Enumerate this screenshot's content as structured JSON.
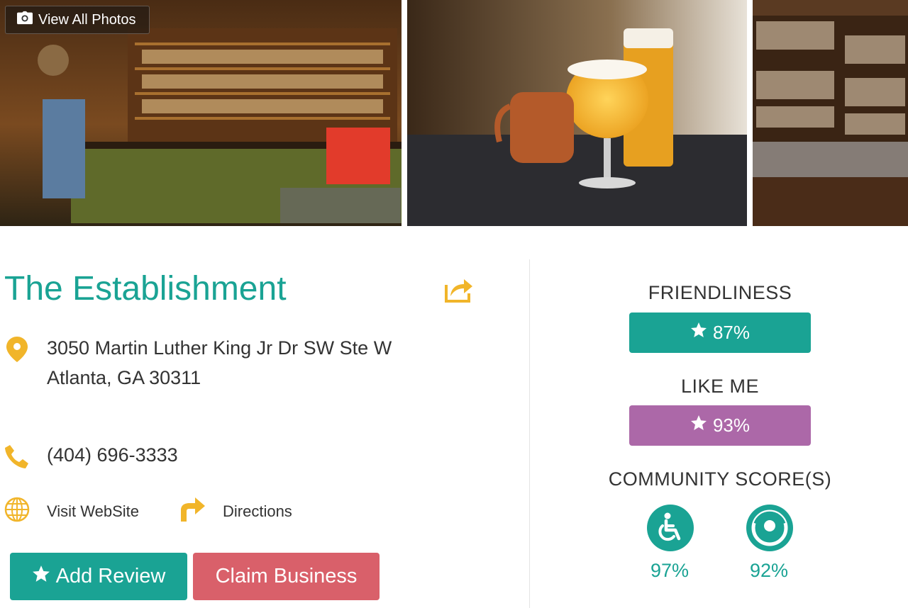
{
  "gallery": {
    "view_all_label": "View All Photos"
  },
  "business": {
    "name": "The Establishment",
    "address_line1": "3050 Martin Luther King Jr Dr SW Ste W",
    "address_line2": "Atlanta, GA 30311",
    "phone": "(404) 696-3333",
    "website_label": "Visit WebSite",
    "directions_label": "Directions"
  },
  "actions": {
    "add_review_label": "Add Review",
    "claim_business_label": "Claim Business"
  },
  "scores": {
    "friendliness_label": "FRIENDLINESS",
    "friendliness_value": "87%",
    "like_me_label": "LIKE ME",
    "like_me_value": "93%",
    "community_label": "COMMUNITY SCORE(S)",
    "community": [
      {
        "icon": "wheelchair-icon",
        "value": "97%"
      },
      {
        "icon": "circle-gauge-icon",
        "value": "92%"
      }
    ]
  },
  "colors": {
    "teal": "#1aa394",
    "purple": "#ac68a8",
    "coral": "#d9606a",
    "gold": "#f1b52a"
  }
}
